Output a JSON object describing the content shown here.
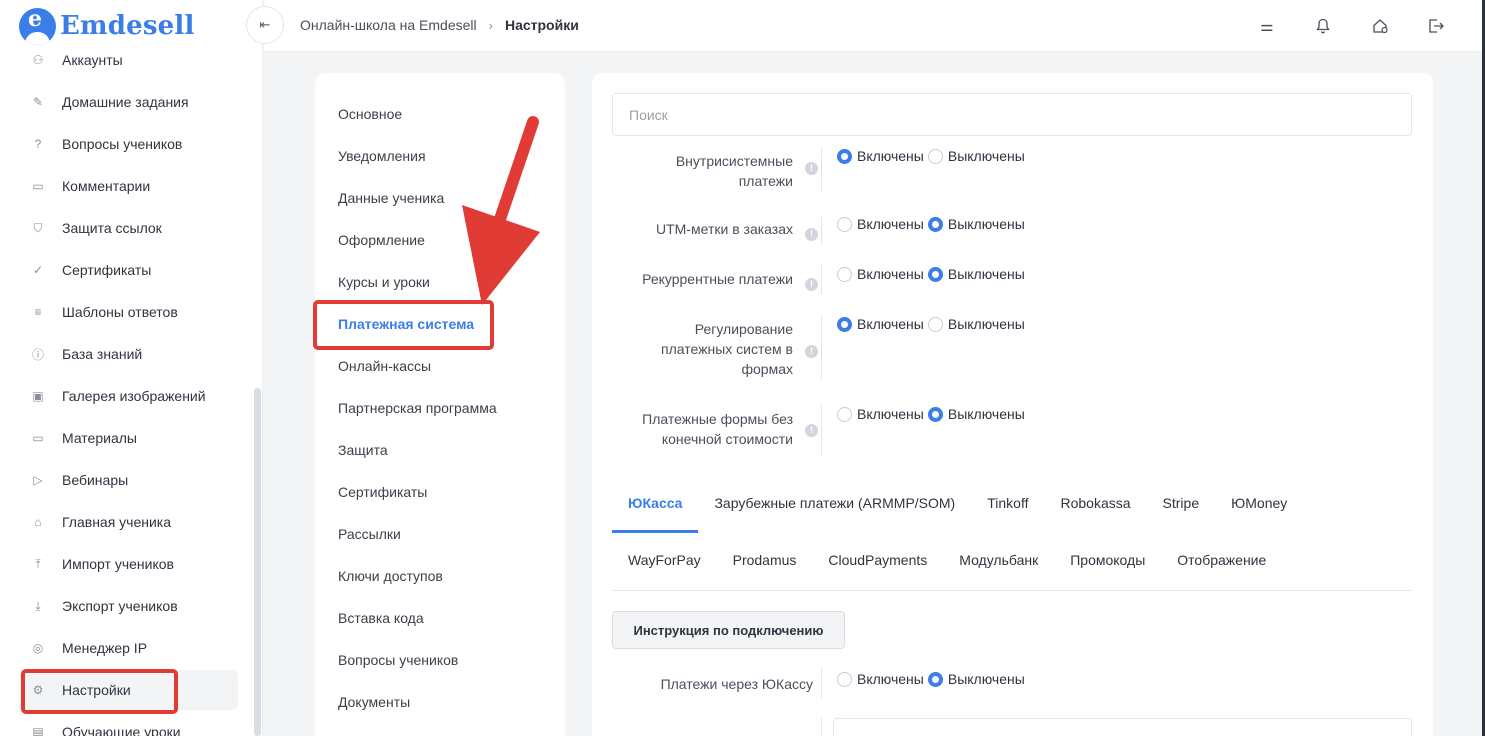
{
  "logo": {
    "letter": "e",
    "text": "Emdesell"
  },
  "sidebar": {
    "items": [
      {
        "label": "Аккаунты",
        "icon": "users-icon",
        "glyph": "⚇"
      },
      {
        "label": "Домашние задания",
        "icon": "pencil-icon",
        "glyph": "✎"
      },
      {
        "label": "Вопросы учеников",
        "icon": "question-icon",
        "glyph": "?"
      },
      {
        "label": "Комментарии",
        "icon": "comment-icon",
        "glyph": "▭"
      },
      {
        "label": "Защита ссылок",
        "icon": "shield-icon",
        "glyph": "⛉"
      },
      {
        "label": "Сертификаты",
        "icon": "badge-check-icon",
        "glyph": "✓"
      },
      {
        "label": "Шаблоны ответов",
        "icon": "list-icon",
        "glyph": "≡"
      },
      {
        "label": "База знаний",
        "icon": "info-icon",
        "glyph": "ⓘ"
      },
      {
        "label": "Галерея изображений",
        "icon": "image-icon",
        "glyph": "▣"
      },
      {
        "label": "Материалы",
        "icon": "folder-icon",
        "glyph": "▭"
      },
      {
        "label": "Вебинары",
        "icon": "play-icon",
        "glyph": "▷"
      },
      {
        "label": "Главная ученика",
        "icon": "home-icon",
        "glyph": "⌂"
      },
      {
        "label": "Импорт учеников",
        "icon": "upload-icon",
        "glyph": "⤒"
      },
      {
        "label": "Экспорт учеников",
        "icon": "download-icon",
        "glyph": "⤓"
      },
      {
        "label": "Менеджер IP",
        "icon": "target-icon",
        "glyph": "◎"
      },
      {
        "label": "Настройки",
        "icon": "gear-icon",
        "glyph": "⚙"
      },
      {
        "label": "Обучающие уроки",
        "icon": "film-icon",
        "glyph": "▤"
      }
    ]
  },
  "header": {
    "collapse_glyph": "⇤",
    "breadcrumb_root": "Онлайн-школа на Emdesell",
    "breadcrumb_sep": "›",
    "breadcrumb_current": "Настройки",
    "icons": [
      {
        "name": "sliders-icon",
        "glyph": "⚌"
      },
      {
        "name": "bell-icon",
        "glyph": "🔔"
      },
      {
        "name": "home-settings-icon",
        "glyph": "⌂"
      },
      {
        "name": "logout-icon",
        "glyph": "⇥"
      }
    ]
  },
  "settings_menu": {
    "items": [
      "Основное",
      "Уведомления",
      "Данные ученика",
      "Оформление",
      "Курсы и уроки",
      "Платежная система",
      "Онлайн-кассы",
      "Партнерская программа",
      "Защита",
      "Сертификаты",
      "Рассылки",
      "Ключи доступов",
      "Вставка кода",
      "Вопросы учеников",
      "Документы"
    ],
    "active_index": 5
  },
  "main": {
    "search_placeholder": "Поиск",
    "info_glyph": "!",
    "on_label": "Включены",
    "off_label": "Выключены",
    "settings": [
      {
        "lines": [
          "Внутрисистемные",
          "платежи"
        ],
        "enabled": true
      },
      {
        "lines": [
          "UTM-метки в заказах"
        ],
        "enabled": false
      },
      {
        "lines": [
          "Рекуррентные платежи"
        ],
        "enabled": false
      },
      {
        "lines": [
          "Регулирование",
          "платежных систем в",
          "формах"
        ],
        "enabled": true
      },
      {
        "lines": [
          "Платежные формы без",
          "конечной стоимости"
        ],
        "enabled": false
      }
    ],
    "tabs_row1": [
      "ЮКасса",
      "Зарубежные платежи (ARMMP/SOM)",
      "Tinkoff",
      "Robokassa",
      "Stripe",
      "ЮMoney"
    ],
    "tabs_row2": [
      "WayForPay",
      "Prodamus",
      "CloudPayments",
      "Модульбанк",
      "Промокоды",
      "Отображение"
    ],
    "active_tab": "ЮКасса",
    "instruction_button": "Инструкция по подключению",
    "yookassa_label": "Платежи через ЮКассу",
    "yookassa_enabled": false
  },
  "colors": {
    "accent": "#3b7de9",
    "highlight": "#e03b35"
  }
}
